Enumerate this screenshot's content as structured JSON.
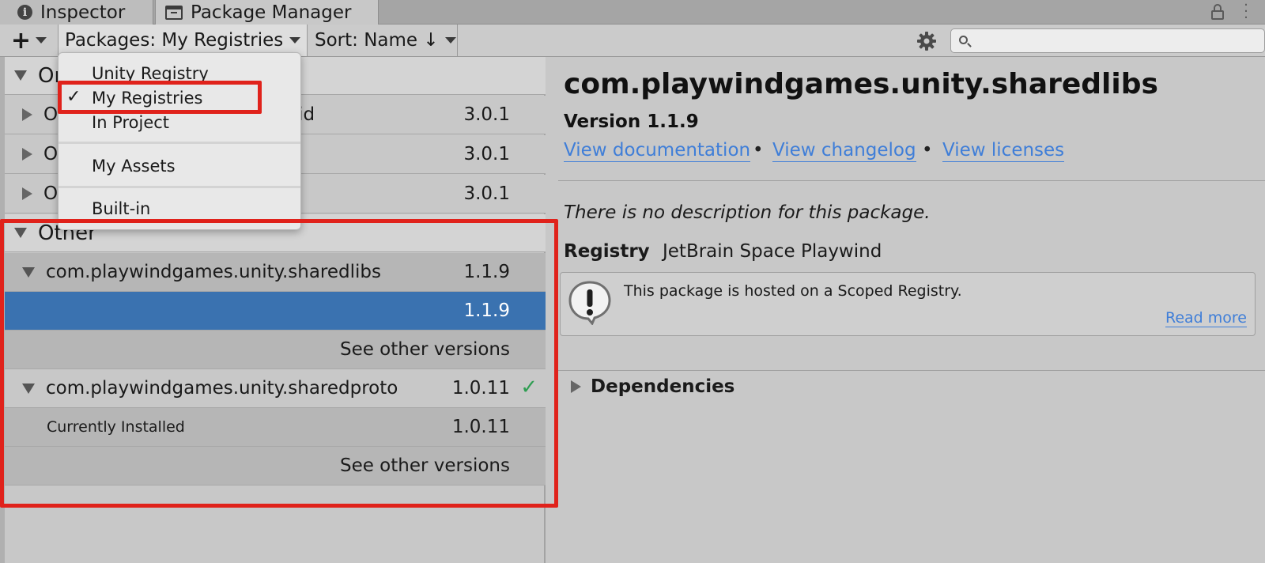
{
  "tabs": {
    "inspector": "Inspector",
    "package_manager": "Package Manager"
  },
  "toolbar": {
    "packages_filter": "Packages: My Registries",
    "sort": "Sort: Name ↓",
    "search_placeholder": ""
  },
  "dropdown": {
    "items": [
      {
        "label": "Unity Registry",
        "checked": false
      },
      {
        "label": "My Registries",
        "checked": true
      },
      {
        "label": "In Project",
        "checked": false
      },
      {
        "label": "My Assets",
        "checked": false
      },
      {
        "label": "Built-in",
        "checked": false
      }
    ],
    "check_mark": "✓"
  },
  "list": {
    "group_o_partial": "Or",
    "o_rows": [
      {
        "name": "O",
        "name_suffix": "oid",
        "version": "3.0.1"
      },
      {
        "name": "O",
        "version": "3.0.1"
      },
      {
        "name": "O",
        "version": "3.0.1"
      }
    ],
    "group_other": "Other",
    "sharedlibs": {
      "name": "com.playwindgames.unity.sharedlibs",
      "version": "1.1.9",
      "selected_version": "1.1.9",
      "see_other": "See other versions"
    },
    "sharedproto": {
      "name": "com.playwindgames.unity.sharedproto",
      "version": "1.0.11",
      "installed_label": "Currently Installed",
      "installed_version": "1.0.11",
      "see_other": "See other versions"
    }
  },
  "detail": {
    "title": "com.playwindgames.unity.sharedlibs",
    "version": "Version 1.1.9",
    "links": {
      "documentation": "View documentation",
      "changelog": "View changelog",
      "licenses": "View licenses",
      "separator": "•"
    },
    "description": "There is no description for this package.",
    "registry_label": "Registry",
    "registry_value": "JetBrain Space Playwind",
    "info_text": "This package is hosted on a Scoped Registry.",
    "read_more": "Read more",
    "dependencies": "Dependencies"
  },
  "colors": {
    "highlight": "#e0221b",
    "selection": "#3a72b0",
    "link": "#3f7ed8",
    "installed_check": "#2f9e52"
  },
  "icons": {
    "inspector_tab": "info-icon",
    "package_manager_tab": "package-icon",
    "lock": "lock-icon",
    "menu": "kebab-menu-icon",
    "add": "plus-icon",
    "settings": "gear-icon",
    "search": "search-icon",
    "warning": "warning-bubble-icon",
    "installed": "checkmark-icon"
  }
}
